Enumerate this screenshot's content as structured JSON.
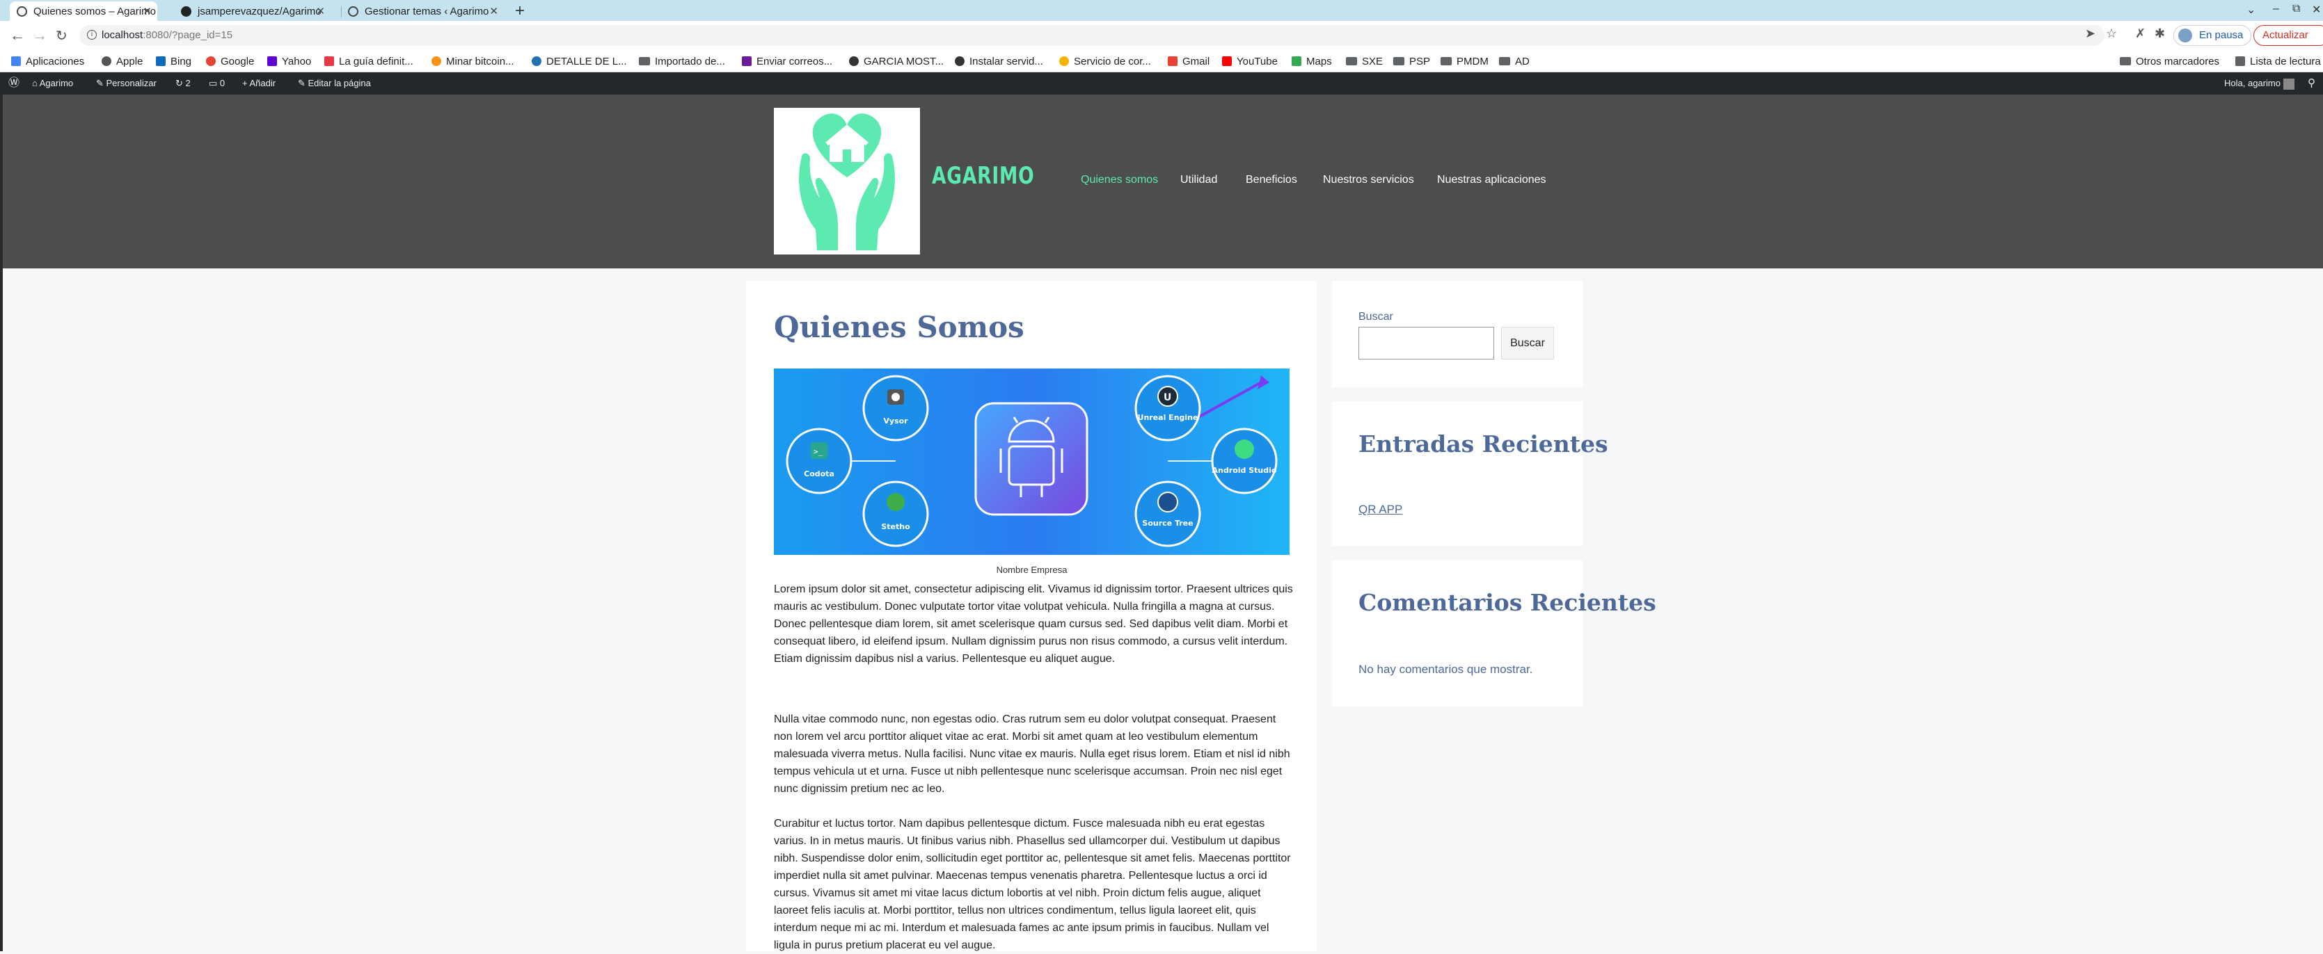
{
  "browser": {
    "tabs": [
      {
        "title": "Quienes somos – Agarimo",
        "active": true
      },
      {
        "title": "jsamperevazquez/Agarimo",
        "active": false
      },
      {
        "title": "Gestionar temas ‹ Agarimo",
        "active": false
      }
    ],
    "url_host": "localhost",
    "url_path": ":8080/?page_id=15",
    "profile_label": "En pausa",
    "update_label": "Actualizar"
  },
  "bookmarks": [
    {
      "label": "Aplicaciones",
      "icon": "apps-grid-icon",
      "color": "#4285f4"
    },
    {
      "label": "Apple",
      "icon": "apple-icon",
      "color": "#555555"
    },
    {
      "label": "Bing",
      "icon": "bing-icon",
      "color": "#0f6cbd"
    },
    {
      "label": "Google",
      "icon": "google-icon",
      "color": "#ea4335"
    },
    {
      "label": "Yahoo",
      "icon": "yahoo-icon",
      "color": "#6001d2"
    },
    {
      "label": "La guía definit...",
      "icon": "link-icon",
      "color": "#e63946"
    },
    {
      "label": "Minar bitcoin...",
      "icon": "bitcoin-icon",
      "color": "#f7931a"
    },
    {
      "label": "DETALLE DE L...",
      "icon": "wordpress-icon",
      "color": "#2271b1"
    },
    {
      "label": "Importado de...",
      "icon": "folder-icon",
      "color": "#5f6368"
    },
    {
      "label": "Enviar correos...",
      "icon": "mail-icon",
      "color": "#6a1b9a"
    },
    {
      "label": "GARCIA MOST...",
      "icon": "globe-icon",
      "color": "#333333"
    },
    {
      "label": "Instalar servid...",
      "icon": "globe-icon",
      "color": "#333333"
    },
    {
      "label": "Servicio de cor...",
      "icon": "sun-icon",
      "color": "#f4b400"
    },
    {
      "label": "Gmail",
      "icon": "gmail-icon",
      "color": "#ea4335"
    },
    {
      "label": "YouTube",
      "icon": "youtube-icon",
      "color": "#ff0000"
    },
    {
      "label": "Maps",
      "icon": "maps-icon",
      "color": "#34a853"
    },
    {
      "label": "SXE",
      "icon": "folder-icon",
      "color": "#5f6368"
    },
    {
      "label": "PSP",
      "icon": "folder-icon",
      "color": "#5f6368"
    },
    {
      "label": "PMDM",
      "icon": "folder-icon",
      "color": "#5f6368"
    },
    {
      "label": "AD",
      "icon": "folder-icon",
      "color": "#5f6368"
    },
    {
      "label": "Otros marcadores",
      "icon": "folder-icon",
      "color": "#5f6368"
    },
    {
      "label": "Lista de lectura",
      "icon": "reading-list-icon",
      "color": "#5f6368"
    }
  ],
  "admin_bar": {
    "site_name": "Agarimo",
    "customize": "Personalizar",
    "updates_count": "2",
    "comments_count": "0",
    "new_label": "Añadir",
    "edit_label": "Editar la página",
    "greeting": "Hola, agarimo"
  },
  "header": {
    "site_title": "AGARIMO",
    "nav": [
      "Quienes somos",
      "Utilidad",
      "Beneficios",
      "Nuestros servicios",
      "Nuestras aplicaciones"
    ],
    "accent": "#5ceab0",
    "bg": "#4d4d4d"
  },
  "page": {
    "title": "Quienes Somos",
    "banner_nodes": [
      "Vysor",
      "Codota",
      "Stetho",
      "Unreal Engine",
      "Android Studio",
      "Source Tree"
    ],
    "caption": "Nombre Empresa",
    "paragraphs": [
      "Lorem ipsum dolor sit amet, consectetur adipiscing elit. Vivamus id dignissim tortor. Praesent ultrices quis mauris ac vestibulum. Donec vulputate tortor vitae volutpat vehicula. Nulla fringilla a magna at cursus. Donec pellentesque diam lorem, sit amet scelerisque quam cursus sed. Sed dapibus velit diam. Morbi et consequat libero, id eleifend ipsum. Nullam dignissim purus non risus commodo, a cursus velit interdum. Etiam dignissim dapibus nisl a varius. Pellentesque eu aliquet augue.",
      "Nulla vitae commodo nunc, non egestas odio. Cras rutrum sem eu dolor volutpat consequat. Praesent non lorem vel arcu porttitor aliquet vitae ac erat. Morbi sit amet quam at leo vestibulum elementum malesuada viverra metus. Nulla facilisi. Nunc vitae ex mauris. Nulla eget risus lorem. Etiam et nisl id nibh tempus vehicula ut et urna. Fusce ut nibh pellentesque nunc scelerisque accumsan. Proin nec nisl eget nunc dignissim pretium nec ac leo.",
      "Curabitur et luctus tortor. Nam dapibus pellentesque dictum. Fusce malesuada nibh eu erat egestas varius. In in metus mauris. Ut finibus varius nibh. Phasellus sed ullamcorper dui. Vestibulum ut dapibus nibh. Suspendisse dolor enim, sollicitudin eget porttitor ac, pellentesque sit amet felis. Maecenas porttitor imperdiet nulla sit amet pulvinar. Maecenas tempus venenatis pharetra. Pellentesque luctus a orci id cursus. Vivamus sit amet mi vitae lacus dictum lobortis at vel nibh. Proin dictum felis augue, aliquet laoreet felis iaculis at. Morbi porttitor, tellus non ultrices condimentum, tellus ligula laoreet elit, quis interdum neque mi ac mi. Interdum et malesuada fames ac ante ipsum primis in faucibus. Nullam vel ligula in purus pretium placerat eu vel augue."
    ]
  },
  "sidebar": {
    "search_label": "Buscar",
    "search_button": "Buscar",
    "recent_posts_title": "Entradas Recientes",
    "recent_posts": [
      "QR APP"
    ],
    "recent_comments_title": "Comentarios Recientes",
    "no_comments": "No hay comentarios que mostrar."
  }
}
